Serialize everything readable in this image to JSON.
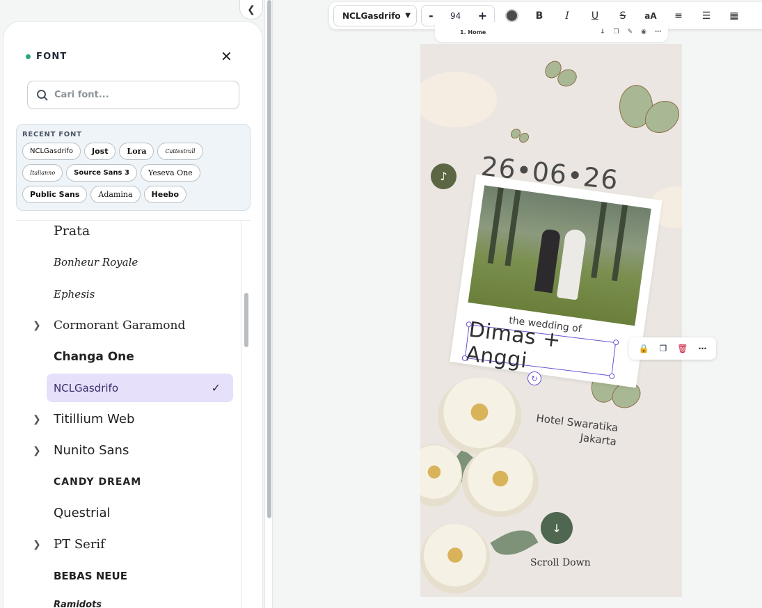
{
  "panel": {
    "title": "FONT",
    "search_placeholder": "Cari font...",
    "recent_title": "RECENT FONT",
    "recent_fonts": [
      "NCLGasdrifo",
      "Jost",
      "Lora",
      "Cattestrall",
      "Italianno",
      "Source Sans 3",
      "Yeseva One",
      "Public Sans",
      "Adamina",
      "Heebo"
    ],
    "fonts": [
      {
        "name": "Prata",
        "expandable": false,
        "selected": false
      },
      {
        "name": "Bonheur Royale",
        "expandable": false,
        "selected": false
      },
      {
        "name": "Ephesis",
        "expandable": false,
        "selected": false
      },
      {
        "name": "Cormorant Garamond",
        "expandable": true,
        "selected": false
      },
      {
        "name": "Changa One",
        "expandable": false,
        "selected": false
      },
      {
        "name": "NCLGasdrifo",
        "expandable": false,
        "selected": true
      },
      {
        "name": "Titillium Web",
        "expandable": true,
        "selected": false
      },
      {
        "name": "Nunito Sans",
        "expandable": true,
        "selected": false
      },
      {
        "name": "CANDY DREAM",
        "expandable": false,
        "selected": false
      },
      {
        "name": "Questrial",
        "expandable": false,
        "selected": false
      },
      {
        "name": "PT Serif",
        "expandable": true,
        "selected": false
      },
      {
        "name": "BEBAS NEUE",
        "expandable": false,
        "selected": false
      },
      {
        "name": "Ramidots",
        "expandable": false,
        "selected": false
      }
    ]
  },
  "toolbar": {
    "font_name": "NCLGasdrifo",
    "font_size": "94",
    "minus": "-",
    "plus": "+",
    "bold": "B",
    "italic": "I",
    "underline": "U",
    "strike": "S",
    "case": "aA",
    "text_color": "#4b4b4b"
  },
  "page_bar": {
    "page_label": "1. Home"
  },
  "invitation": {
    "date": "26•06•26",
    "wedding_of": "the wedding of",
    "names": "Dimas + Anggi",
    "venue_line1": "Hotel Swaratika",
    "venue_line2": "Jakarta",
    "scroll_text": "Scroll Down"
  },
  "colors": {
    "selected_bg": "#e6e0fb",
    "accent_purple": "#6d4fd1",
    "music_btn": "#5c6644",
    "scroll_btn": "#4f6650",
    "delete_red": "#c8102e"
  }
}
